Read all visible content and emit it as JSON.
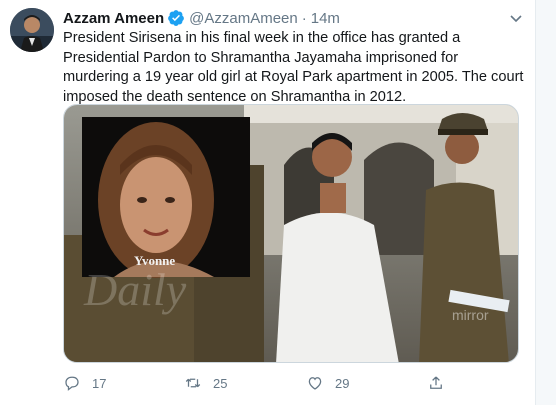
{
  "tweet": {
    "author_name": "Azzam Ameen",
    "handle": "@AzzamAmeen",
    "separator": "·",
    "time": "14m",
    "text": "President Sirisena in his final week in the office has granted a Presidential Pardon to Shramantha Jayamaha imprisoned for  murdering a 19 year old girl at Royal Park apartment in 2005. The court imposed the death sentence on Shramantha in 2012.",
    "media": {
      "inset_caption": "Yvonne",
      "watermark": "Daily",
      "watermark_tail": "mirror"
    },
    "actions": {
      "reply_count": "17",
      "retweet_count": "25",
      "like_count": "29"
    }
  },
  "colors": {
    "accent": "#1da1f2",
    "muted": "#657786",
    "border": "#e6ecf0"
  },
  "icons": {
    "verified": "verified-badge-icon",
    "caret": "chevron-down-icon",
    "reply": "reply-icon",
    "retweet": "retweet-icon",
    "like": "heart-icon",
    "share": "share-icon"
  }
}
